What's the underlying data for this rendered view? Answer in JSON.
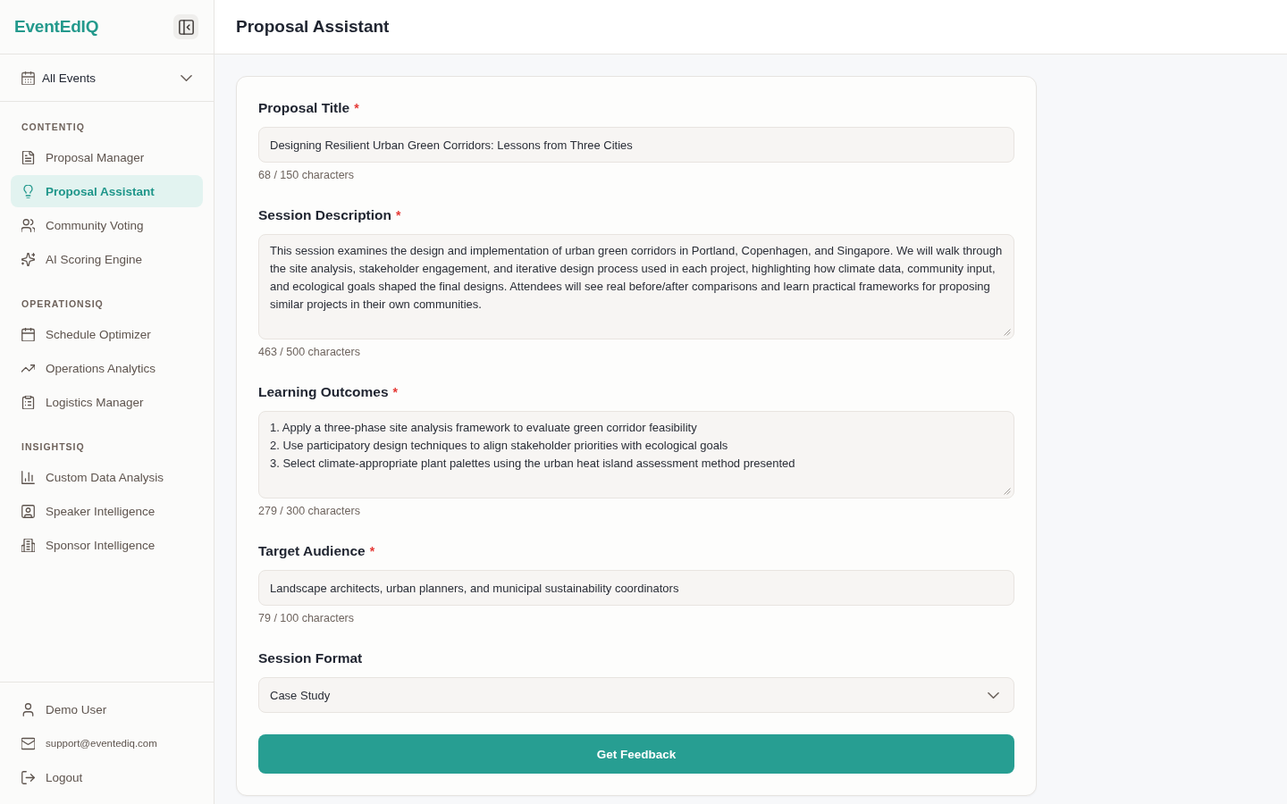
{
  "sidebar": {
    "logo": "EventEdIQ",
    "event_selector": {
      "label": "All Events"
    },
    "sections": [
      {
        "heading": "CONTENTIQ",
        "items": [
          {
            "label": "Proposal Manager",
            "selected": false
          },
          {
            "label": "Proposal Assistant",
            "selected": true
          },
          {
            "label": "Community Voting",
            "selected": false
          },
          {
            "label": "AI Scoring Engine",
            "selected": false
          }
        ]
      },
      {
        "heading": "OPERATIONSIQ",
        "items": [
          {
            "label": "Schedule Optimizer",
            "selected": false
          },
          {
            "label": "Operations Analytics",
            "selected": false
          },
          {
            "label": "Logistics Manager",
            "selected": false
          }
        ]
      },
      {
        "heading": "INSIGHTSIQ",
        "items": [
          {
            "label": "Custom Data Analysis",
            "selected": false
          },
          {
            "label": "Speaker Intelligence",
            "selected": false
          },
          {
            "label": "Sponsor Intelligence",
            "selected": false
          }
        ]
      }
    ],
    "footer": [
      {
        "kind": "user",
        "label": "Demo User"
      },
      {
        "kind": "email",
        "label": "support@eventediq.com"
      },
      {
        "kind": "logout",
        "label": "Logout"
      }
    ]
  },
  "header": {
    "title": "Proposal Assistant"
  },
  "form": {
    "fields": [
      {
        "kind": "input",
        "label": "Proposal Title",
        "required_mark": "*",
        "value": "Designing Resilient Urban Green Corridors: Lessons from Three Cities",
        "counter": "68 / 150 characters"
      },
      {
        "kind": "textarea",
        "label": "Session Description",
        "required_mark": "*",
        "value": "This session examines the design and implementation of urban green corridors in Portland, Copenhagen, and Singapore. We will walk through the site analysis, stakeholder engagement, and iterative design process used in each project, highlighting how climate data, community input, and ecological goals shaped the final designs. Attendees will see real before/after comparisons and learn practical frameworks for proposing similar projects in their own communities.",
        "counter": "463 / 500 characters"
      },
      {
        "kind": "textarea",
        "label": "Learning Outcomes",
        "required_mark": "*",
        "value": "1. Apply a three-phase site analysis framework to evaluate green corridor feasibility\n2. Use participatory design techniques to align stakeholder priorities with ecological goals\n3. Select climate-appropriate plant palettes using the urban heat island assessment method presented",
        "counter": "279 / 300 characters"
      },
      {
        "kind": "input",
        "label": "Target Audience",
        "required_mark": "*",
        "value": "Landscape architects, urban planners, and municipal sustainability coordinators",
        "counter": "79 / 100 characters"
      },
      {
        "kind": "select",
        "label": "Session Format",
        "value": "Case Study"
      }
    ],
    "submit": "Get Feedback"
  }
}
